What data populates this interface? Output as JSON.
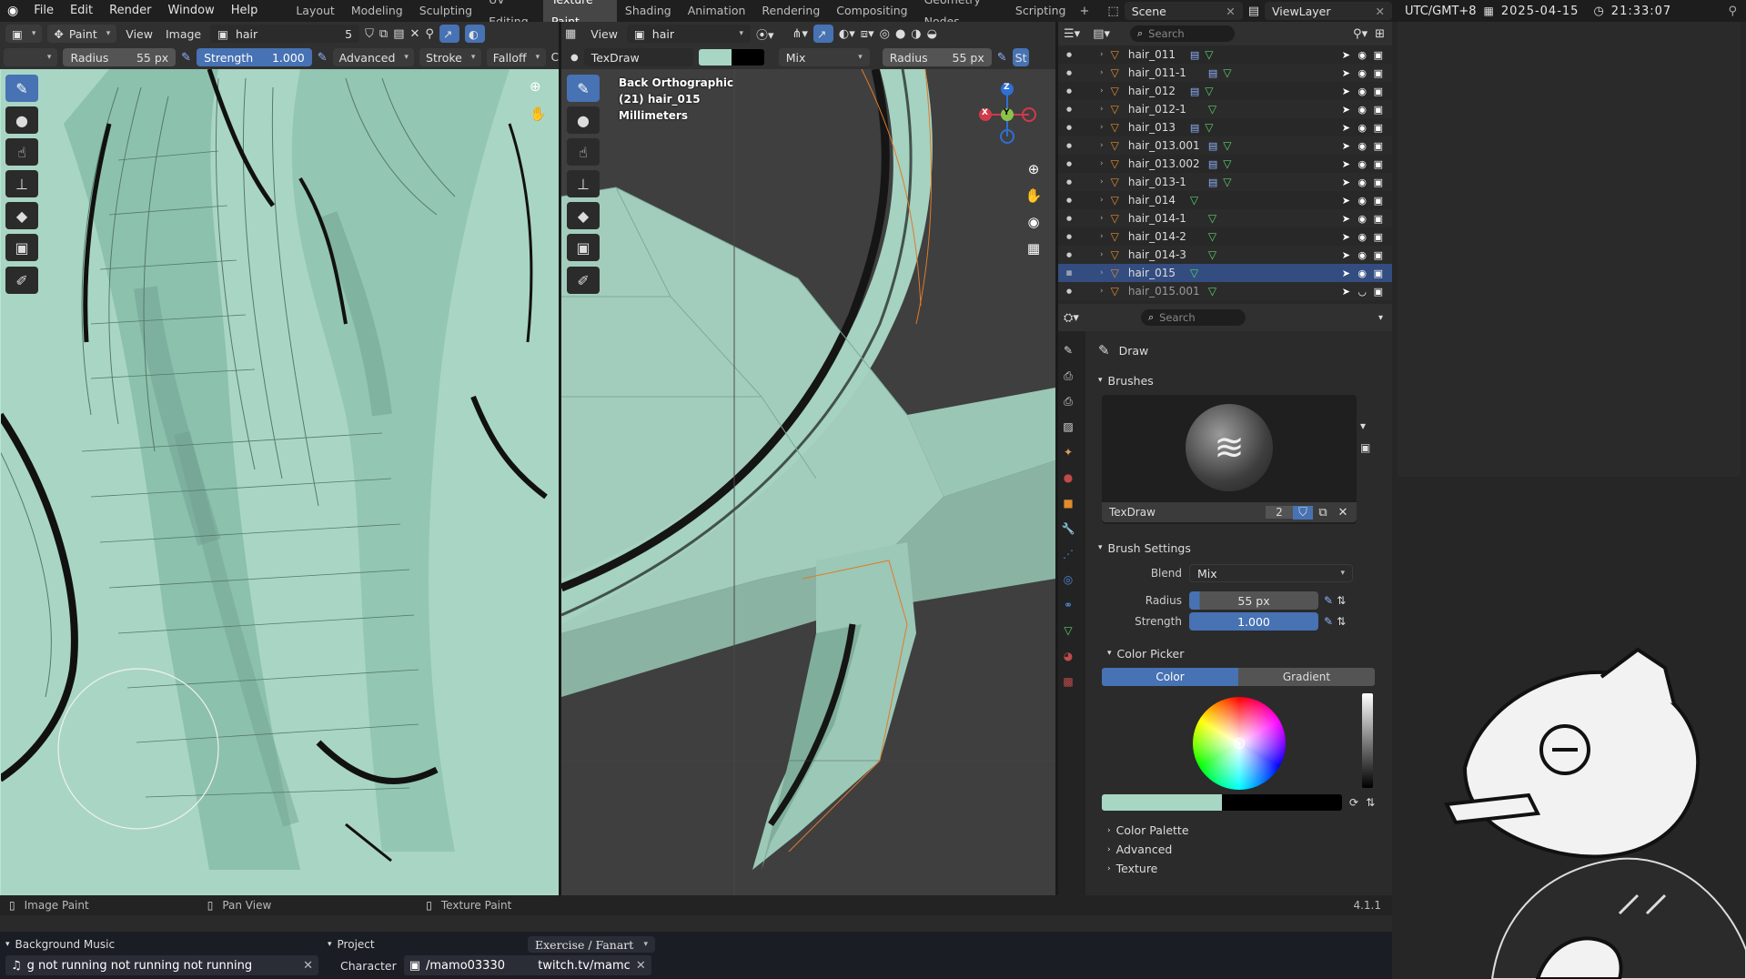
{
  "menus": [
    "File",
    "Edit",
    "Render",
    "Window",
    "Help"
  ],
  "workspaces": [
    {
      "label": "Layout"
    },
    {
      "label": "Modeling"
    },
    {
      "label": "Sculpting"
    },
    {
      "label": "UV Editing"
    },
    {
      "label": "Texture Paint",
      "active": true
    },
    {
      "label": "Shading"
    },
    {
      "label": "Animation"
    },
    {
      "label": "Rendering"
    },
    {
      "label": "Compositing"
    },
    {
      "label": "Geometry Nodes"
    },
    {
      "label": "Scripting"
    }
  ],
  "scene": {
    "name": "Scene",
    "view_layer": "ViewLayer"
  },
  "clock": {
    "timezone": "UTC/GMT+8",
    "date": "2025-04-15",
    "time": "21:33:07"
  },
  "image_editor": {
    "mode": "Paint",
    "view": "View",
    "image_menu": "Image",
    "image_name": "hair",
    "users": "5",
    "tool_settings": {
      "radius_label": "Radius",
      "radius": "55 px",
      "strength_label": "Strength",
      "strength": "1.000",
      "advanced": "Advanced",
      "stroke": "Stroke",
      "falloff": "Falloff",
      "cut": "C"
    }
  },
  "viewport": {
    "view": "View",
    "image_name": "hair",
    "brush_name": "TexDraw",
    "blend": "Mix",
    "radius_label": "Radius",
    "radius": "55 px",
    "cut": "St",
    "overlay_lines": [
      "Back Orthographic",
      "(21) hair_015",
      "Millimeters"
    ],
    "gizmo": {
      "x": "X",
      "y": "Y",
      "z": "Z"
    }
  },
  "outliner": {
    "search_placeholder": "Search",
    "items": [
      {
        "name": "hair_011",
        "mod": true
      },
      {
        "name": "hair_011-1",
        "mod": true
      },
      {
        "name": "hair_012",
        "mod": true
      },
      {
        "name": "hair_012-1",
        "mod": false
      },
      {
        "name": "hair_013",
        "mod": true
      },
      {
        "name": "hair_013.001",
        "mod": true
      },
      {
        "name": "hair_013.002",
        "mod": true
      },
      {
        "name": "hair_013-1",
        "mod": true
      },
      {
        "name": "hair_014",
        "mod": false
      },
      {
        "name": "hair_014-1",
        "mod": false
      },
      {
        "name": "hair_014-2",
        "mod": false
      },
      {
        "name": "hair_014-3",
        "mod": false
      },
      {
        "name": "hair_015",
        "mod": false,
        "selected": true
      },
      {
        "name": "hair_015.001",
        "mod": false,
        "dim": true
      }
    ]
  },
  "properties": {
    "search_placeholder": "Search",
    "tool_name": "Draw",
    "brushes_header": "Brushes",
    "brush_name": "TexDraw",
    "brush_users": "2",
    "brush_settings_header": "Brush Settings",
    "blend_label": "Blend",
    "blend": "Mix",
    "radius_label": "Radius",
    "radius": "55 px",
    "strength_label": "Strength",
    "strength": "1.000",
    "color_picker_header": "Color Picker",
    "color_tab": "Color",
    "gradient_tab": "Gradient",
    "primary_color": "#9fd4c0",
    "secondary_color": "#000000",
    "collapsed": [
      "Color Palette",
      "Advanced",
      "Texture"
    ]
  },
  "statusbar": {
    "items": [
      "Image Paint",
      "Pan View",
      "Texture Paint"
    ],
    "version": "4.1.1"
  },
  "obs": {
    "music_header": "Background Music",
    "music_text": "g  not running  not running  not running",
    "project_header": "Project",
    "project_value": "Exercise / Fanart",
    "character_label": "Character",
    "character_value": "/mamo03330",
    "link_text": "twitch.tv/mamc"
  },
  "colors": {
    "accent": "#4772b3",
    "paint": "#a8d6c4",
    "outliner_selected": "#334d80"
  }
}
